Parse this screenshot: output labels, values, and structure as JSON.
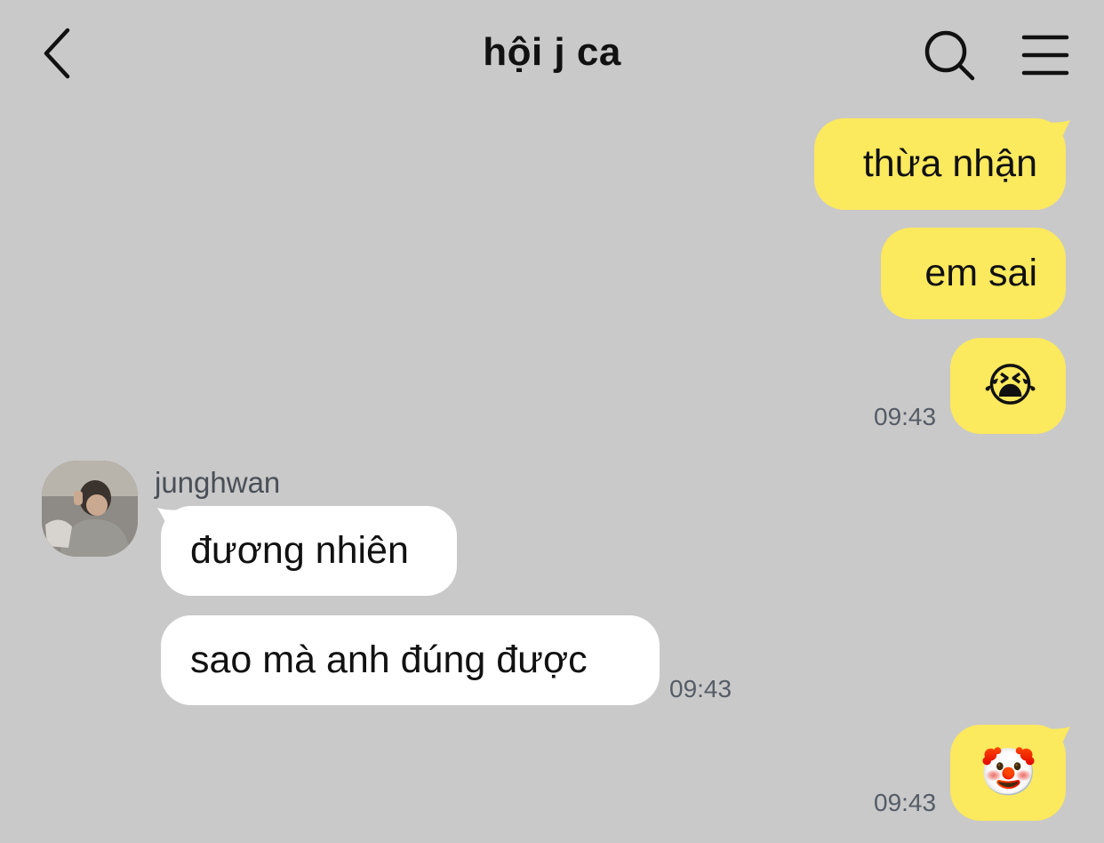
{
  "header": {
    "title": "hội j ca",
    "icons": [
      "chevron-left-icon",
      "search-icon",
      "menu-icon"
    ]
  },
  "messages": {
    "m1": {
      "text": "thừa nhận"
    },
    "m2": {
      "text": "em sai"
    },
    "m3": {
      "emoji": "😭",
      "time": "09:43"
    },
    "sender_name": "junghwan",
    "m4": {
      "text": "đương nhiên"
    },
    "m5": {
      "text": "sao mà anh đúng được",
      "time": "09:43"
    },
    "m6": {
      "emoji": "🤡",
      "time": "09:43"
    }
  },
  "colors": {
    "background": "#c9c9c9",
    "my_bubble": "#fbe95e",
    "their_bubble": "#ffffff",
    "timestamp": "#555c66"
  }
}
